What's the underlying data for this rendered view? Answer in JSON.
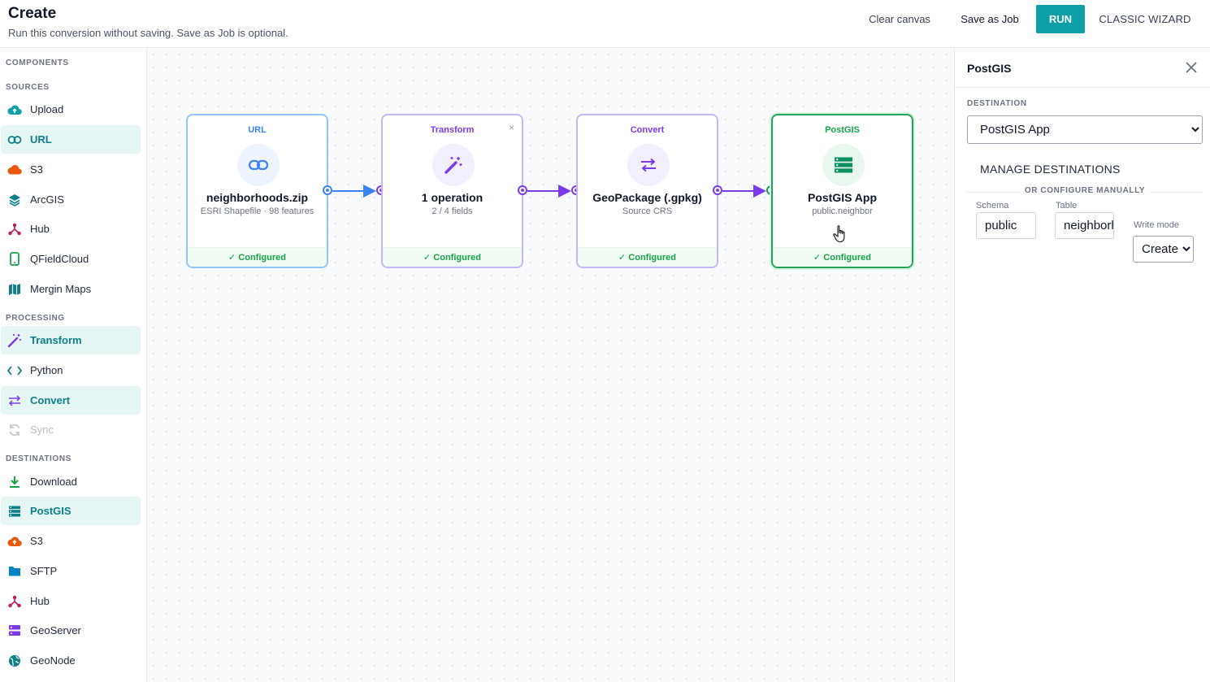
{
  "header": {
    "title": "Create",
    "subtitle": "Run this conversion without saving. Save as Job is optional.",
    "clear_canvas": "Clear canvas",
    "save_as_job": "Save as Job",
    "run": "RUN",
    "classic_wizard": "CLASSIC WIZARD",
    "run_color": "#0e9fa8"
  },
  "sidebar": {
    "components_label": "COMPONENTS",
    "sources_label": "SOURCES",
    "processing_label": "PROCESSING",
    "destinations_label": "DESTINATIONS",
    "sources": [
      {
        "label": "Upload",
        "icon": "cloud-upload-icon"
      },
      {
        "label": "URL",
        "icon": "link-icon",
        "active": true
      },
      {
        "label": "S3",
        "icon": "cloud-icon"
      },
      {
        "label": "ArcGIS",
        "icon": "layers-icon"
      },
      {
        "label": "Hub",
        "icon": "hub-icon"
      },
      {
        "label": "QFieldCloud",
        "icon": "phone-icon"
      },
      {
        "label": "Mergin Maps",
        "icon": "map-icon"
      }
    ],
    "processing": [
      {
        "label": "Transform",
        "icon": "magic-wand-icon",
        "active": true
      },
      {
        "label": "Python",
        "icon": "code-icon"
      },
      {
        "label": "Convert",
        "icon": "swap-icon",
        "active": true
      },
      {
        "label": "Sync",
        "icon": "sync-icon",
        "disabled": true
      }
    ],
    "destinations": [
      {
        "label": "Download",
        "icon": "download-icon"
      },
      {
        "label": "PostGIS",
        "icon": "database-icon",
        "active": true
      },
      {
        "label": "S3",
        "icon": "cloud-upload-icon"
      },
      {
        "label": "SFTP",
        "icon": "folder-icon"
      },
      {
        "label": "Hub",
        "icon": "hub-icon"
      },
      {
        "label": "GeoServer",
        "icon": "server-icon"
      },
      {
        "label": "GeoNode",
        "icon": "globe-icon"
      }
    ]
  },
  "nodes": [
    {
      "kind": "URL",
      "title": "neighborhoods.zip",
      "subtitle": "ESRI Shapefile · 98 features",
      "status": "✓ Configured",
      "color": "#3b82f6",
      "border": "#93c5fd",
      "icon": "link-icon"
    },
    {
      "kind": "Transform",
      "title": "1 operation",
      "subtitle": "2 / 4 fields",
      "status": "✓ Configured",
      "color": "#7c3aed",
      "border": "#c4b5fd",
      "icon": "magic-wand-icon",
      "close": "×"
    },
    {
      "kind": "Convert",
      "title": "GeoPackage (.gpkg)",
      "subtitle": "Source CRS",
      "status": "✓ Configured",
      "color": "#7c3aed",
      "border": "#c4b5fd",
      "icon": "swap-icon"
    },
    {
      "kind": "PostGIS",
      "title": "PostGIS App",
      "subtitle": "public.neighbor",
      "status": "✓ Configured",
      "color": "#16a34a",
      "border": "#22a55a",
      "icon": "database-icon"
    }
  ],
  "panel": {
    "title": "PostGIS",
    "destination_label": "DESTINATION",
    "destination_value": "PostGIS App",
    "manage_destinations": "MANAGE DESTINATIONS",
    "or_configure": "OR CONFIGURE MANUALLY",
    "schema_label": "Schema",
    "schema_value": "public",
    "table_label": "Table",
    "table_value": "neighborhoods",
    "write_mode_label": "Write mode",
    "write_mode_value": "Create"
  }
}
